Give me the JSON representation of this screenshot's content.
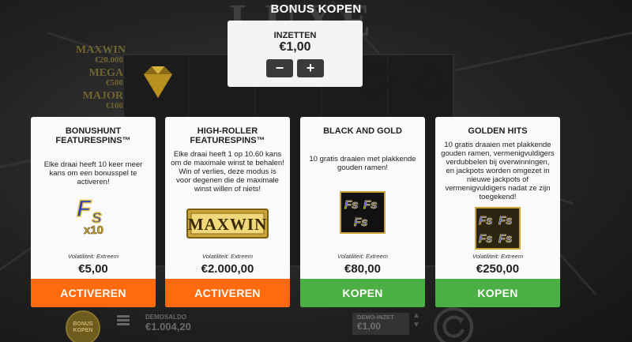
{
  "game": {
    "logo": "LUXE",
    "jackpots": [
      {
        "name": "MAXWIN",
        "value": "€20.000"
      },
      {
        "name": "MEGA",
        "value": "€500"
      },
      {
        "name": "MAJOR",
        "value": "€100"
      }
    ]
  },
  "modal": {
    "title": "BONUS KOPEN",
    "bet": {
      "label": "INZETTEN",
      "value": "€1,00",
      "minus_label": "−",
      "plus_label": "+"
    }
  },
  "cards": [
    {
      "title": "BONUSHUNT FEATURESPINS™",
      "description": "Elke draai heeft 10 keer meer kans om een bonusspel te activeren!",
      "art_label": "FS x10",
      "volatility": "Volatiliteit: Extreem",
      "price": "€5,00",
      "button": "ACTIVEREN",
      "button_color": "#ff6a0c"
    },
    {
      "title": "HIGH-ROLLER FEATURESPINS™",
      "description": "Elke draai heeft 1 op 10.60 kans om de maximale winst te behalen! Win of verlies, deze modus is voor degenen die de maximale winst willen of niets!",
      "art_label": "MAXWIN",
      "volatility": "Volatiliteit: Extreem",
      "price": "€2.000,00",
      "button": "ACTIVEREN",
      "button_color": "#ff6a0c"
    },
    {
      "title": "BLACK AND GOLD",
      "description": "10 gratis draaien met plakkende gouden ramen!",
      "art_label": "FS FS FS",
      "volatility": "Volatiliteit: Extreem",
      "price": "€80,00",
      "button": "KOPEN",
      "button_color": "#4caf43"
    },
    {
      "title": "GOLDEN HITS",
      "description": "10 gratis draaien met plakkende gouden ramen, vermenigvuldigers verdubbelen bij overwinningen, en jackpots worden omgezet in nieuwe jackpots of vermenigvuldigers nadat ze zijn toegekend!",
      "art_label": "FS FS FS FS",
      "volatility": "Volatiliteit: Extreem",
      "price": "€250,00",
      "button": "KOPEN",
      "button_color": "#4caf43"
    }
  ],
  "bottom": {
    "bonus_button": "BONUS KOPEN",
    "saldo_label": "DEMOSALDO",
    "saldo_value": "€1.004,20",
    "inzet_label": "DEMO-INZET",
    "inzet_value": "€1,00"
  },
  "colors": {
    "activate": "#ff6a0c",
    "buy": "#4caf43",
    "gold": "#d4a72c",
    "fs_blue": "#2a3fbf"
  }
}
